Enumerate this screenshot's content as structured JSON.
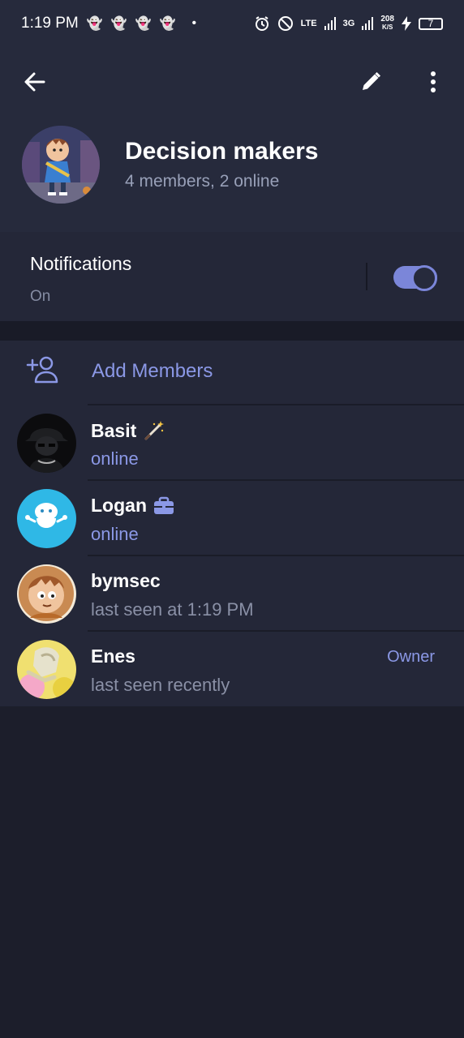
{
  "status_bar": {
    "time": "1:19 PM",
    "network_lte": "LTE",
    "network_3g": "3G",
    "speed": "208",
    "speed_unit": "K/S",
    "battery": "7"
  },
  "header": {
    "title": "Decision makers",
    "subtitle": "4 members, 2 online"
  },
  "notifications": {
    "title": "Notifications",
    "state": "On",
    "enabled": true
  },
  "members_section": {
    "add_label": "Add Members",
    "members": [
      {
        "name": "Basit",
        "status": "online",
        "badge_icon": "magic-wand-icon",
        "role": ""
      },
      {
        "name": "Logan",
        "status": "online",
        "badge_icon": "briefcase-icon",
        "role": ""
      },
      {
        "name": "bymsec",
        "status": "last seen at 1:19 PM",
        "badge_icon": "",
        "role": ""
      },
      {
        "name": "Enes",
        "status": "last seen recently",
        "badge_icon": "",
        "role": "Owner"
      }
    ]
  },
  "colors": {
    "accent": "#8b98e6",
    "header_bg": "#262a3c",
    "section_bg": "#242738",
    "page_bg": "#1c1e2b"
  }
}
